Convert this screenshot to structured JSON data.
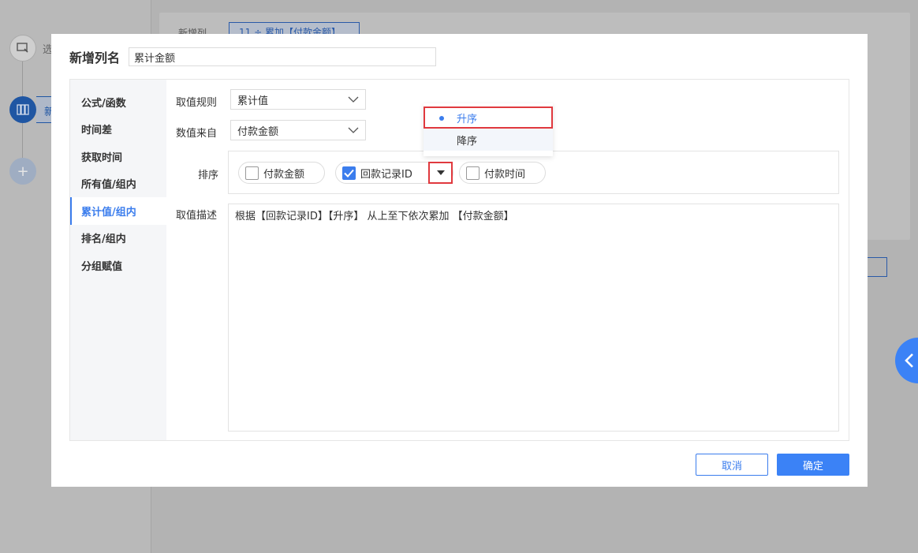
{
  "background": {
    "step1_label": "选",
    "step2_label": "新",
    "add_label": "+",
    "new_column_label": "新增列",
    "tag_text": "11 ÷ 累加【付款金额】"
  },
  "modal": {
    "title": "新增列名",
    "name_value": "累计金额"
  },
  "menu": {
    "items": [
      {
        "label": "公式/函数"
      },
      {
        "label": "时间差"
      },
      {
        "label": "获取时间"
      },
      {
        "label": "所有值/组内"
      },
      {
        "label": "累计值/组内"
      },
      {
        "label": "排名/组内"
      },
      {
        "label": "分组赋值"
      }
    ],
    "active_index": 4
  },
  "form": {
    "rule_label": "取值规则",
    "rule_value": "累计值",
    "source_label": "数值来自",
    "source_value": "付款金额",
    "sort_label": "排序",
    "sort_options": [
      {
        "label": "付款金额",
        "checked": false
      },
      {
        "label": "回款记录ID",
        "checked": true
      },
      {
        "label": "付款时间",
        "checked": false
      }
    ],
    "desc_label": "取值描述",
    "desc_value": "根据【回款记录ID】【升序】 从上至下依次累加 【付款金额】"
  },
  "sort_dropdown": {
    "options": [
      "升序",
      "降序"
    ],
    "selected": "升序"
  },
  "buttons": {
    "cancel": "取消",
    "ok": "确定"
  },
  "colors": {
    "accent": "#3b7ded",
    "highlight": "#e0393e"
  },
  "icons": {
    "chevron_down": "chevron-down-icon",
    "check": "check-icon",
    "caret_down": "caret-down-icon",
    "chevron_left": "chevron-left-icon"
  }
}
